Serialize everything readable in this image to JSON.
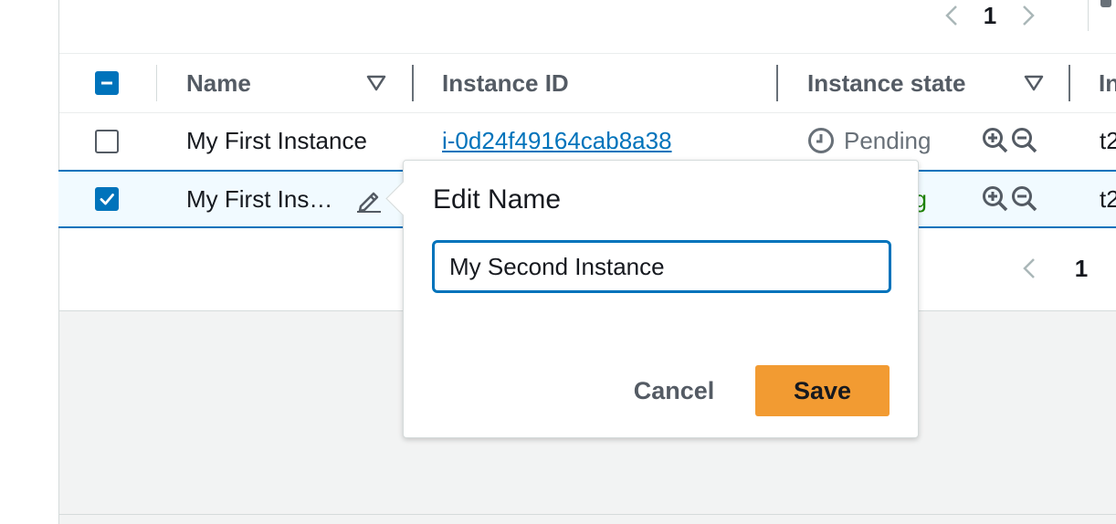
{
  "colors": {
    "link": "#0073bb",
    "accent": "#0073bb",
    "save_button": "#f29b32",
    "running_green": "#1d8102"
  },
  "top_pager": {
    "prev_icon": "chevron-left-icon",
    "page": "1",
    "next_icon": "chevron-right-icon"
  },
  "table": {
    "header_checkbox_state": "indeterminate",
    "columns": [
      {
        "label": "Name",
        "sortable": true
      },
      {
        "label": "Instance ID",
        "sortable": false
      },
      {
        "label": "Instance state",
        "sortable": true
      },
      {
        "label": "In",
        "sortable": false
      }
    ],
    "rows": [
      {
        "selected": false,
        "name": "My First Instance",
        "instance_id": "i-0d24f49164cab8a38",
        "state": "Pending",
        "state_icon": "clock-icon",
        "type": "t2"
      },
      {
        "selected": true,
        "name": "My First Ins…",
        "edit_icon": "pencil-icon",
        "state": "ng",
        "type": "t2"
      }
    ]
  },
  "bottom_pager": {
    "prev_icon": "chevron-left-icon",
    "page": "1"
  },
  "edit_popover": {
    "title": "Edit Name",
    "input_value": "My Second Instance",
    "cancel_label": "Cancel",
    "save_label": "Save"
  }
}
